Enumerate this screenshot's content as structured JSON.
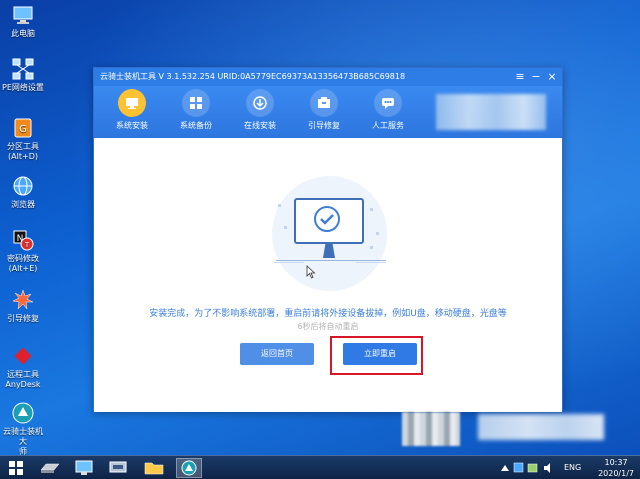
{
  "desktop": {
    "icons": [
      {
        "label": "此电脑"
      },
      {
        "label": "PE网络设置"
      },
      {
        "label": "分区工具",
        "sub": "(Alt+D)"
      },
      {
        "label": "浏览器"
      },
      {
        "label": "密码修改",
        "sub": "(Alt+E)"
      },
      {
        "label": "引导修复"
      },
      {
        "label": "远程工具",
        "sub": "AnyDesk"
      },
      {
        "label": "云骑士装机大",
        "sub": "师"
      }
    ]
  },
  "window": {
    "title": "云骑士装机工具 V 3.1.532.254 URID:0A5779EC69373A13356473B685C69818",
    "controls": {
      "menu": "≡",
      "minimize": "−",
      "close": "×"
    },
    "nav": [
      {
        "label": "系统安装",
        "icon": "system-install-icon",
        "active": true
      },
      {
        "label": "系统备份",
        "icon": "system-backup-icon",
        "active": false
      },
      {
        "label": "在线安装",
        "icon": "online-install-icon",
        "active": false
      },
      {
        "label": "引导修复",
        "icon": "boot-repair-icon",
        "active": false
      },
      {
        "label": "人工服务",
        "icon": "support-icon",
        "active": false
      }
    ],
    "message": "安装完成，为了不影响系统部署，重启前请将外接设备拔掉，例如U盘，移动硬盘，光盘等",
    "countdown": "6秒后将自动重启",
    "buttons": {
      "back": "返回首页",
      "restart": "立即重启"
    }
  },
  "taskbar": {
    "tray": {
      "lang": "ENG"
    },
    "clock": {
      "time": "10:37",
      "date": "2020/1/7"
    }
  },
  "colors": {
    "accent": "#2e7de6",
    "highlight": "#d8162a",
    "message": "#3a7fdc"
  }
}
